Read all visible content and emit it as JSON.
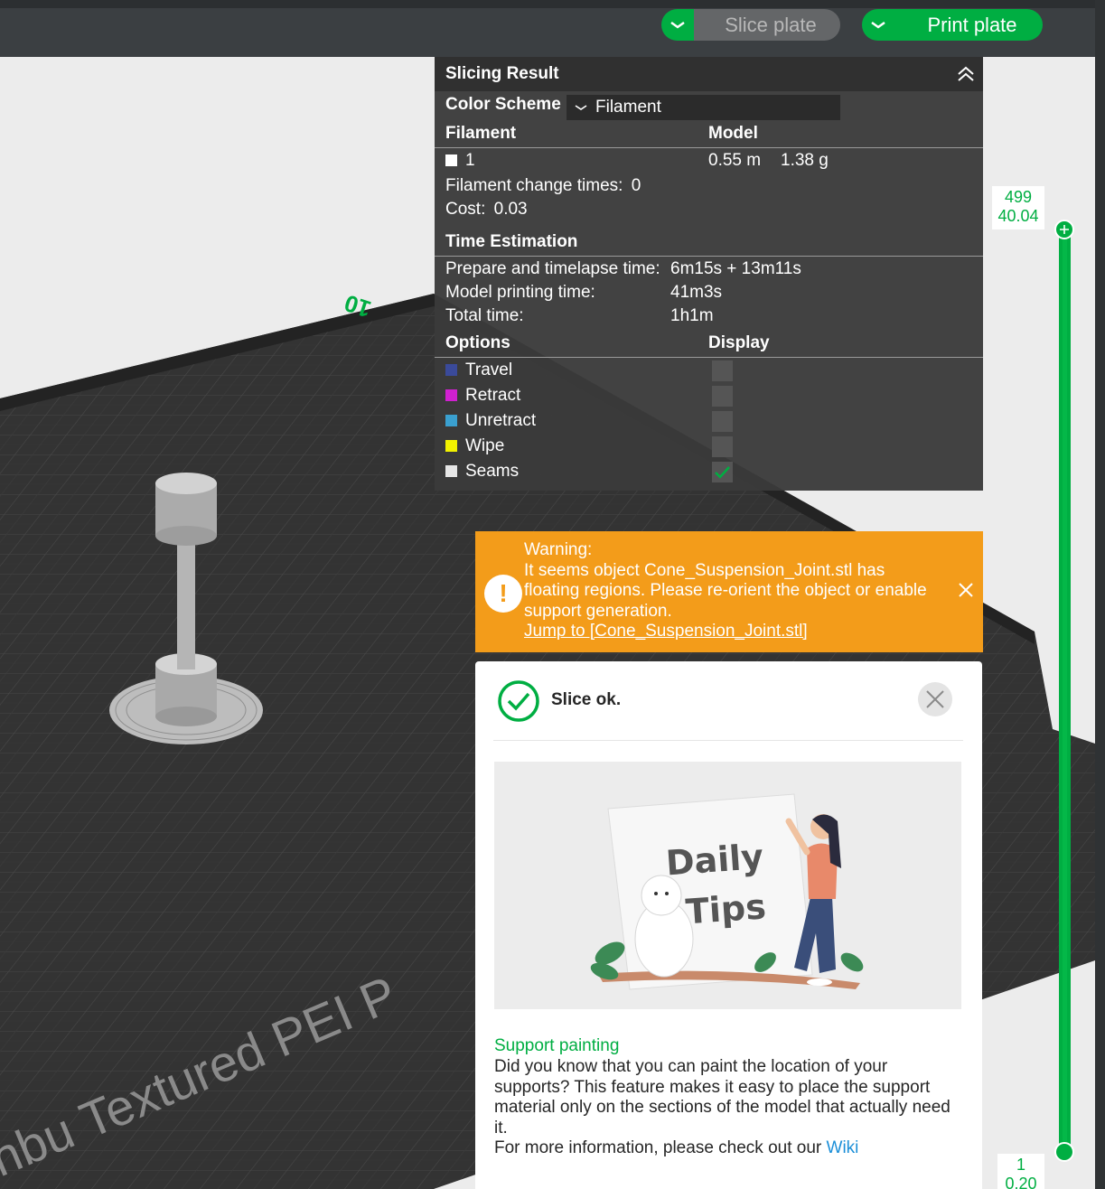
{
  "toolbar": {
    "slice_label": "Slice plate",
    "print_label": "Print plate"
  },
  "viewport": {
    "bed_text": "nbu Textured PEI P",
    "axis_number": "10"
  },
  "slicing_result": {
    "title": "Slicing Result",
    "color_scheme_label": "Color Scheme",
    "color_scheme_value": "Filament",
    "filament_header": "Filament",
    "model_header": "Model",
    "filament_id": "1",
    "filament_length": "0.55 m",
    "filament_weight": "1.38 g",
    "change_times_label": "Filament change times:",
    "change_times_value": "0",
    "cost_label": "Cost:",
    "cost_value": "0.03",
    "time_title": "Time Estimation",
    "prepare_label": "Prepare and timelapse time:",
    "prepare_value": "6m15s + 13m11s",
    "model_time_label": "Model printing time:",
    "model_time_value": "41m3s",
    "total_label": "Total time:",
    "total_value": "1h1m",
    "options_header": "Options",
    "display_header": "Display",
    "options": [
      {
        "label": "Travel",
        "color": "#3a4a9a",
        "checked": false
      },
      {
        "label": "Retract",
        "color": "#d020d0",
        "checked": false
      },
      {
        "label": "Unretract",
        "color": "#3aa0d0",
        "checked": false
      },
      {
        "label": "Wipe",
        "color": "#f2f200",
        "checked": false
      },
      {
        "label": "Seams",
        "color": "#e6e6e6",
        "checked": true
      }
    ]
  },
  "warning": {
    "heading": "Warning:",
    "line1": "It seems object Cone_Suspension_Joint.stl has",
    "line2": "floating regions. Please re-orient the object or enable",
    "line3": "support generation.",
    "link": "Jump to [Cone_Suspension_Joint.stl]"
  },
  "slice_card": {
    "title": "Slice ok.",
    "image_text_1": "Daily",
    "image_text_2": "Tips",
    "tip_title": "Support painting",
    "tip_body": "Did you know that you can paint the location of your supports? This feature makes it easy to place the support material only on the sections of the model that actually need it.",
    "tip_more": "For more information, please check out our ",
    "tip_link": "Wiki"
  },
  "layer_slider": {
    "top_layer": "499",
    "top_height": "40.04",
    "bottom_layer": "1",
    "bottom_height": "0.20"
  },
  "colors": {
    "accent": "#00ae42",
    "warning": "#f39c1a"
  }
}
